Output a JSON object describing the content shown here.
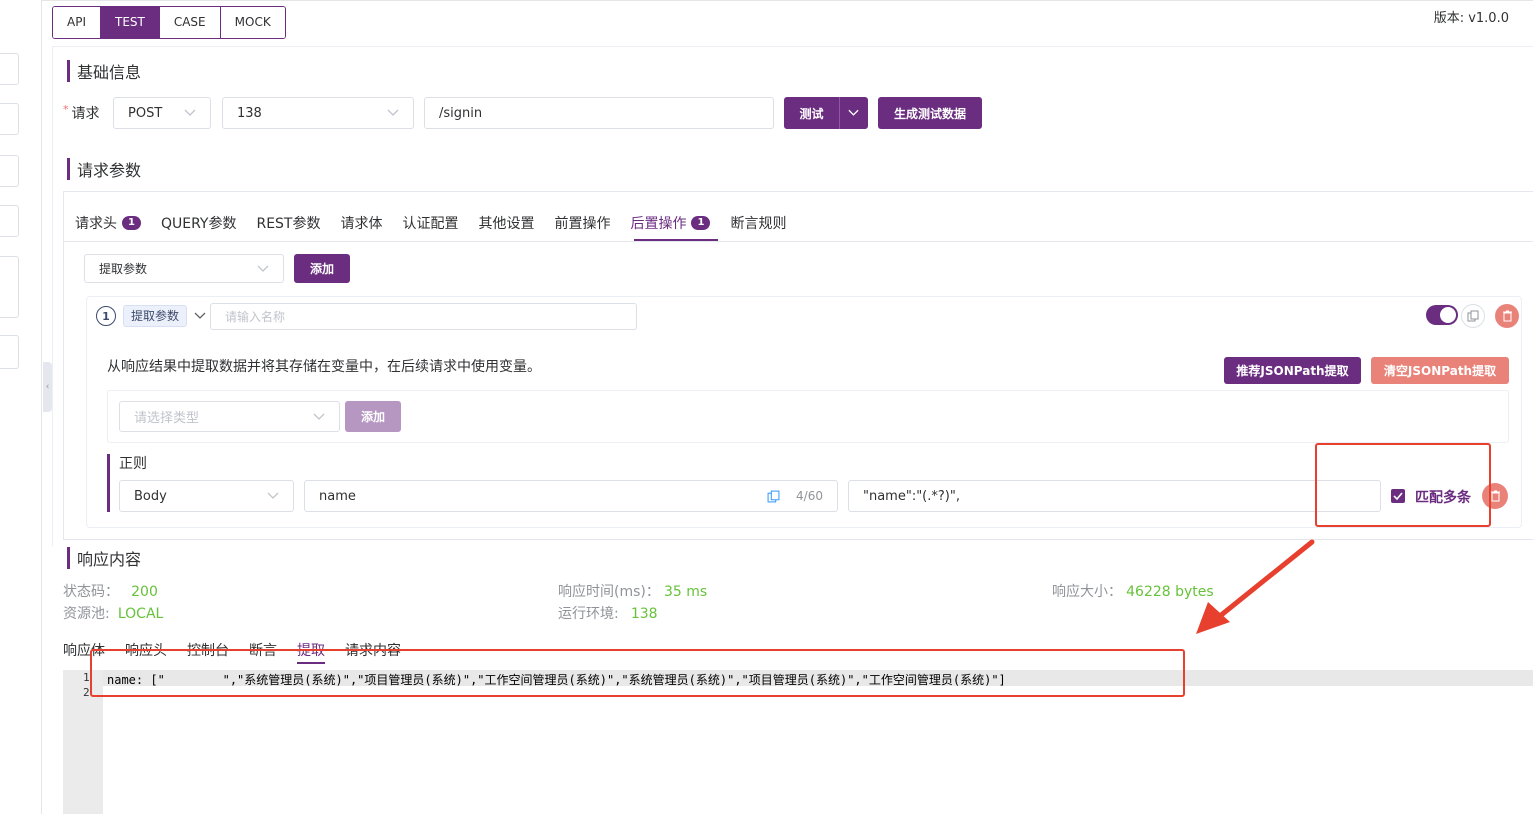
{
  "top_tabs": [
    "API",
    "TEST",
    "CASE",
    "MOCK"
  ],
  "version": "版本: v1.0.0",
  "basic": {
    "title": "基础信息",
    "required_mark": "*",
    "request_label": "请求",
    "method": "POST",
    "env": "138",
    "path": "/signin",
    "test_button": "测试",
    "gen_button": "生成测试数据"
  },
  "params": {
    "title": "请求参数",
    "tabs": [
      {
        "label": "请求头",
        "badge": "1"
      },
      {
        "label": "QUERY参数"
      },
      {
        "label": "REST参数"
      },
      {
        "label": "请求体"
      },
      {
        "label": "认证配置"
      },
      {
        "label": "其他设置"
      },
      {
        "label": "前置操作"
      },
      {
        "label": "后置操作",
        "badge": "1",
        "active": true
      },
      {
        "label": "断言规则"
      }
    ],
    "op_select": "提取参数",
    "add_button": "添加"
  },
  "extract_card": {
    "index": "1",
    "tag": "提取参数",
    "name_placeholder": "请输入名称",
    "description": "从响应结果中提取数据并将其存储在变量中，在后续请求中使用变量。",
    "recommend_button": "推荐JSONPath提取",
    "clear_button": "清空JSONPath提取",
    "type_placeholder": "请选择类型",
    "type_add_button": "添加",
    "regex_title": "正则",
    "source": "Body",
    "var_name": "name",
    "counter": "4/60",
    "expression": "\"name\":\"(.*?)\",",
    "multi_match": "匹配多条"
  },
  "response": {
    "title": "响应内容",
    "status_label": "状态码：",
    "status_value": "200",
    "pool_label": "资源池:",
    "pool_value": "LOCAL",
    "time_label": "响应时间(ms)：",
    "time_value": "35 ms",
    "env_label": "运行环境:",
    "env_value": "138",
    "size_label": "响应大小：",
    "size_value": "46228 bytes",
    "tabs": [
      "响应体",
      "响应头",
      "控制台",
      "断言",
      "提取",
      "请求内容"
    ],
    "active_tab": "提取",
    "lines": [
      "1",
      "2"
    ],
    "code": "name: [\"        \",\"系统管理员(系统)\",\"项目管理员(系统)\",\"工作空间管理员(系统)\",\"系统管理员(系统)\",\"项目管理员(系统)\",\"工作空间管理员(系统)\"]"
  },
  "colors": {
    "primary": "#6b2d80",
    "danger": "#e9837a",
    "success": "#67c23a",
    "annotation": "#e8402f"
  },
  "icons": [
    "chevron-down-icon",
    "copy-icon",
    "trash-icon",
    "arrow-annotation",
    "checkbox-checked-icon"
  ]
}
